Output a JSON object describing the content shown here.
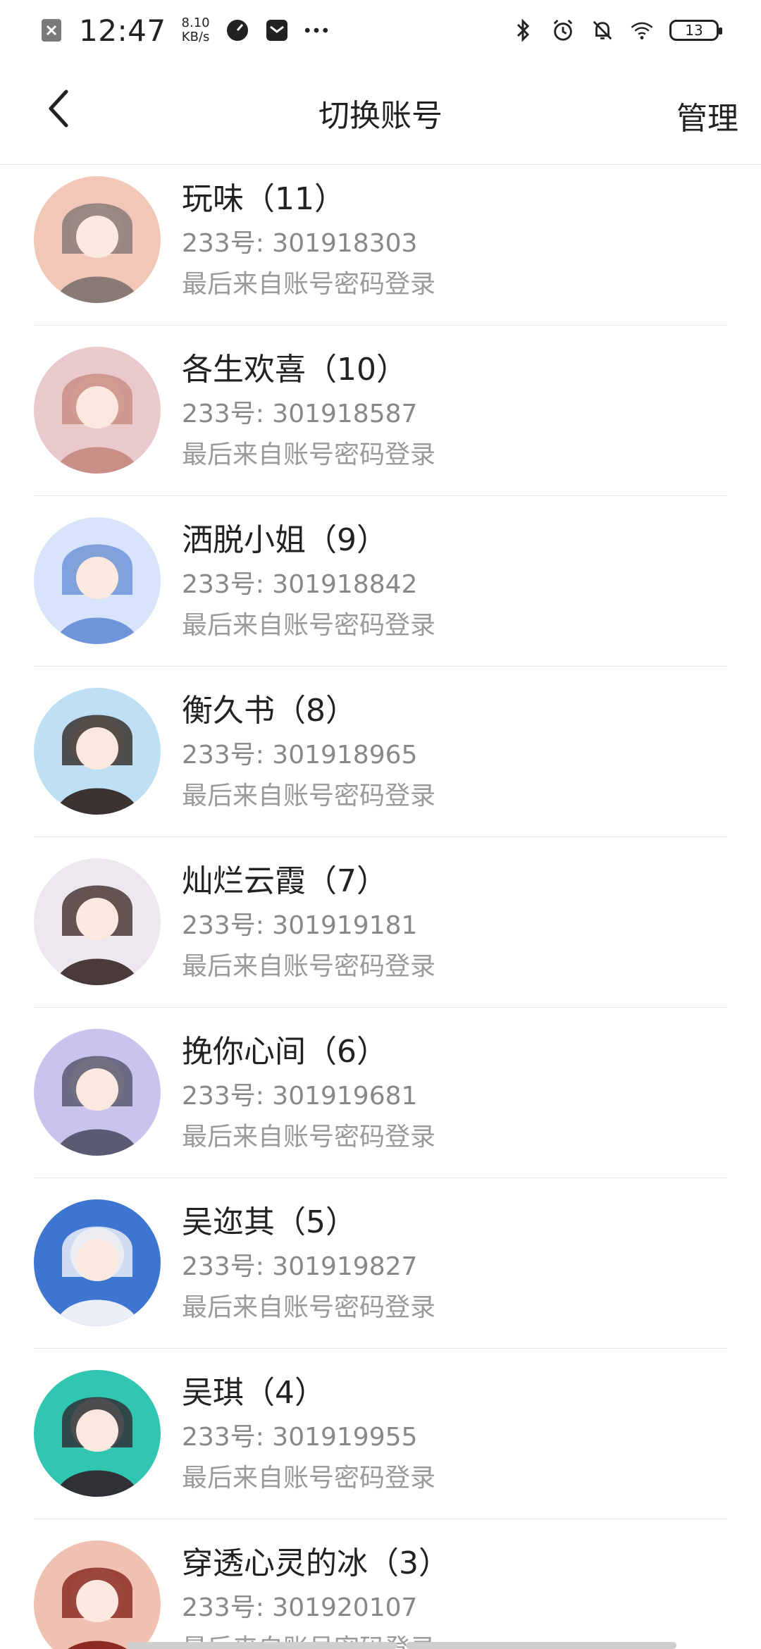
{
  "status": {
    "time": "12:47",
    "speed_value": "8.10",
    "speed_unit": "KB/s",
    "battery": "13"
  },
  "header": {
    "title": "切换账号",
    "manage_label": "管理"
  },
  "accounts": [
    {
      "name": "玩味（11）",
      "id": "233号: 301918303",
      "login": "最后来自账号密码登录",
      "avatar_colors": [
        "#f2c7b8",
        "#8a7a76"
      ]
    },
    {
      "name": "各生欢喜（10）",
      "id": "233号: 301918587",
      "login": "最后来自账号密码登录",
      "avatar_colors": [
        "#eac9cd",
        "#c98f86"
      ]
    },
    {
      "name": "洒脱小姐（9）",
      "id": "233号: 301918842",
      "login": "最后来自账号密码登录",
      "avatar_colors": [
        "#d7e4fb",
        "#6e95d9"
      ]
    },
    {
      "name": "衡久书（8）",
      "id": "233号: 301918965",
      "login": "最后来自账号密码登录",
      "avatar_colors": [
        "#bfe0f4",
        "#3a3330"
      ]
    },
    {
      "name": "灿烂云霞（7）",
      "id": "233号: 301919181",
      "login": "最后来自账号密码登录",
      "avatar_colors": [
        "#ece8ee",
        "#4a3a3a"
      ]
    },
    {
      "name": "挽你心间（6）",
      "id": "233号: 301919681",
      "login": "最后来自账号密码登录",
      "avatar_colors": [
        "#c8c4ee",
        "#5a5a72"
      ]
    },
    {
      "name": "吴迩其（5）",
      "id": "233号: 301919827",
      "login": "最后来自账号密码登录",
      "avatar_colors": [
        "#3e75d1",
        "#e9eef7"
      ]
    },
    {
      "name": "吴琪（4）",
      "id": "233号: 301919955",
      "login": "最后来自账号密码登录",
      "avatar_colors": [
        "#30c6b1",
        "#2f3137"
      ]
    },
    {
      "name": "穿透心灵的冰（3）",
      "id": "233号: 301920107",
      "login": "最后来自账号密码登录",
      "avatar_colors": [
        "#f0c1b3",
        "#8c2b23"
      ]
    }
  ],
  "icons": {
    "back": "chevron-left-icon",
    "bluetooth": "bluetooth-icon",
    "alarm": "alarm-icon",
    "mute": "bell-off-icon",
    "wifi": "wifi-icon"
  }
}
